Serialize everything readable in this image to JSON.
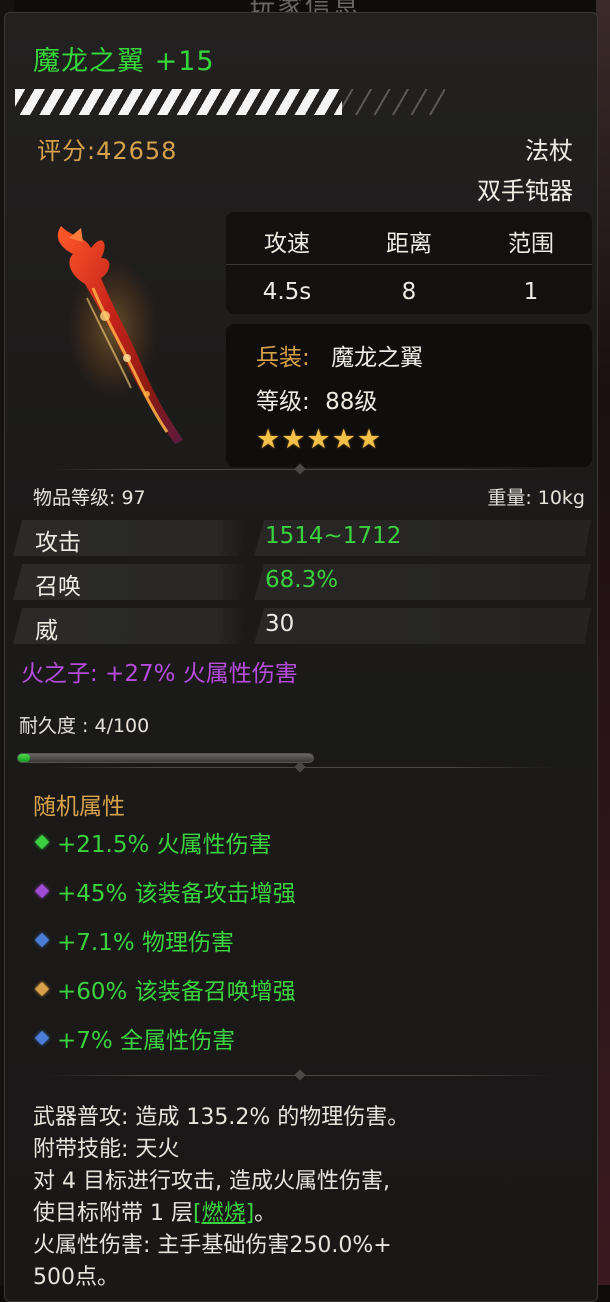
{
  "window": {
    "header_title": "玩家信息"
  },
  "item": {
    "title": "魔龙之翼 +15",
    "score": "评分:42658",
    "category": "法杖",
    "subcategory": "双手钝器",
    "enhance_progress": 0.76
  },
  "stats_table": {
    "headers": [
      "攻速",
      "距离",
      "范围"
    ],
    "values": [
      "4.5s",
      "8",
      "1"
    ]
  },
  "info": {
    "weapon_label": "兵装:",
    "weapon_name": "魔龙之翼",
    "level_label": "等级:",
    "level_value": "88级",
    "stars": "★★★★★",
    "star_count": 5
  },
  "meta": {
    "item_level": "物品等级: 97",
    "weight": "重量: 10kg"
  },
  "attributes": [
    {
      "name": "攻击",
      "value": "1514~1712"
    },
    {
      "name": "召唤",
      "value": "68.3%"
    },
    {
      "name": "威",
      "value": "30"
    }
  ],
  "set_bonus": "火之子: +27% 火属性伤害",
  "durability": {
    "label": "耐久度 : 4/100",
    "fraction": 0.04
  },
  "random_attrs": {
    "title": "随机属性",
    "items": [
      {
        "text": "+21.5% 火属性伤害",
        "gem_color": "#3ad23f"
      },
      {
        "text": "+45% 该装备攻击增强",
        "gem_color": "#a04bd6"
      },
      {
        "text": "+7.1% 物理伤害",
        "gem_color": "#4a7ed8"
      },
      {
        "text": "+60% 该装备召唤增强",
        "gem_color": "#d6a14a"
      },
      {
        "text": "+7% 全属性伤害",
        "gem_color": "#4a7ed8"
      }
    ]
  },
  "description": {
    "line1": "武器普攻: 造成 135.2% 的物理伤害。",
    "line2": "附带技能: 天火",
    "line3": "对 4 目标进行攻击, 造成火属性伤害,",
    "line4_pre": "使目标附带 1 层",
    "line4_link": "[燃烧]",
    "line4_post": "。",
    "line5": "火属性伤害: 主手基础伤害250.0%+",
    "line6": "500点。"
  },
  "colors": {
    "title_green": "#35d63a",
    "gold": "#d6a14a",
    "purple": "#b64cdb",
    "stat_green": "#3ad23f"
  }
}
